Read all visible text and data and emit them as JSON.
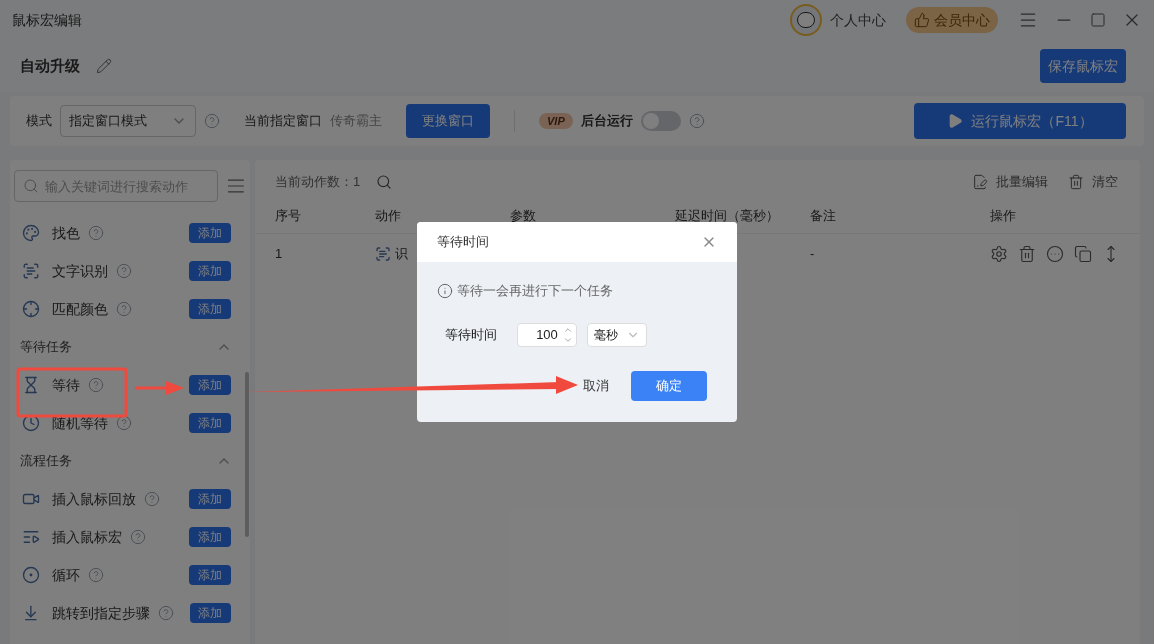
{
  "window": {
    "title": "鼠标宏编辑",
    "user": "个人中心",
    "member": "会员中心"
  },
  "macro": {
    "name": "自动升级",
    "save": "保存鼠标宏"
  },
  "toolbar": {
    "mode_label": "模式",
    "mode": "指定窗口模式",
    "window_label": "当前指定窗口",
    "window": "传奇霸主",
    "change": "更换窗口",
    "vip": "VIP",
    "background_label": "后台运行",
    "background_on": false,
    "run": "运行鼠标宏（F11）"
  },
  "sidebar": {
    "placeholder": "输入关键词进行搜索动作",
    "entries": [
      {
        "kind": "item",
        "label": "找色",
        "add": "添加"
      },
      {
        "kind": "item",
        "label": "文字识别",
        "add": "添加"
      },
      {
        "kind": "item",
        "label": "匹配颜色",
        "add": "添加"
      },
      {
        "kind": "header",
        "label": "等待任务",
        "expanded": true
      },
      {
        "kind": "item",
        "label": "等待",
        "add": "添加"
      },
      {
        "kind": "item",
        "label": "随机等待",
        "add": "添加"
      },
      {
        "kind": "header",
        "label": "流程任务",
        "expanded": true
      },
      {
        "kind": "item",
        "label": "插入鼠标回放",
        "add": "添加"
      },
      {
        "kind": "item",
        "label": "插入鼠标宏",
        "add": "添加"
      },
      {
        "kind": "item",
        "label": "循环",
        "add": "添加"
      },
      {
        "kind": "item",
        "label": "跳转到指定步骤",
        "add": "添加"
      }
    ]
  },
  "main": {
    "count": "当前动作数：1",
    "batch": "批量编辑",
    "clear": "清空",
    "columns": [
      "序号",
      "动作",
      "参数",
      "延迟时间（毫秒）",
      "备注",
      "操作"
    ],
    "rows": [
      {
        "index": "1",
        "action": "识",
        "note": "-"
      }
    ]
  },
  "dialog": {
    "title": "等待时间",
    "info": "等待一会再进行下一个任务",
    "field_label": "等待时间",
    "value": "100",
    "unit": "毫秒",
    "cancel": "取消",
    "ok": "确定"
  }
}
